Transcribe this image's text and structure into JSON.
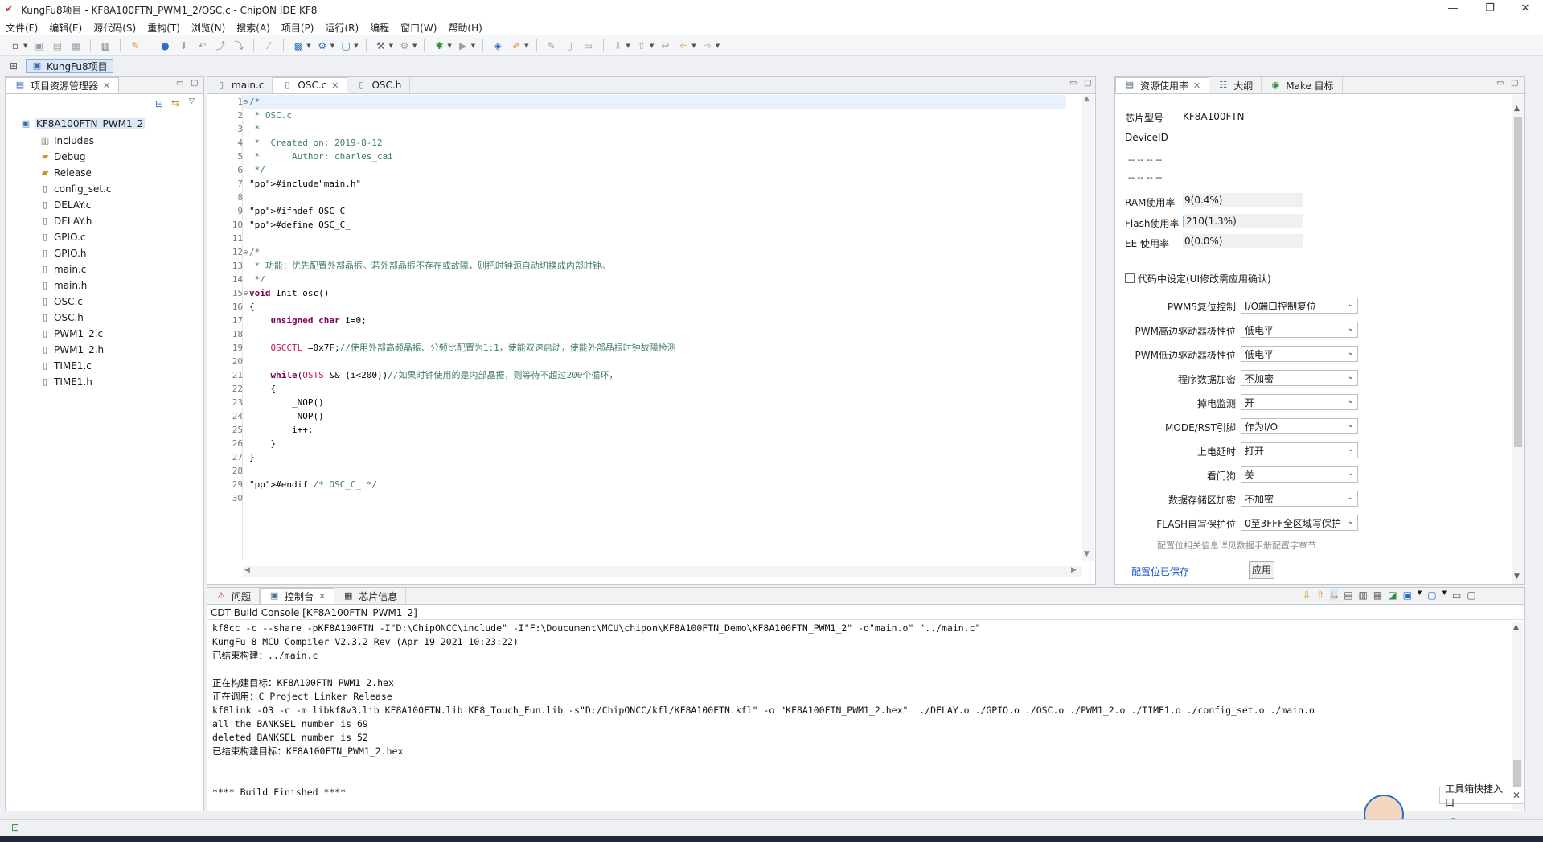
{
  "window": {
    "title": "KungFu8项目 - KF8A100FTN_PWM1_2/OSC.c - ChipON IDE KF8",
    "minimize": "—",
    "maximize": "❐",
    "close": "✕"
  },
  "menu": [
    "文件(F)",
    "编辑(E)",
    "源代码(S)",
    "重构(T)",
    "浏览(N)",
    "搜索(A)",
    "项目(P)",
    "运行(R)",
    "编程",
    "窗口(W)",
    "帮助(H)"
  ],
  "perspective": {
    "label": "KungFu8项目"
  },
  "project_explorer": {
    "tab_label": "项目资源管理器",
    "project": "KF8A100FTN_PWM1_2",
    "items": [
      {
        "label": "Includes",
        "icon": "includes-icon"
      },
      {
        "label": "Debug",
        "icon": "folder-icon"
      },
      {
        "label": "Release",
        "icon": "folder-icon"
      },
      {
        "label": "config_set.c",
        "icon": "c-file-icon"
      },
      {
        "label": "DELAY.c",
        "icon": "c-file-icon"
      },
      {
        "label": "DELAY.h",
        "icon": "h-file-icon"
      },
      {
        "label": "GPIO.c",
        "icon": "c-file-icon"
      },
      {
        "label": "GPIO.h",
        "icon": "h-file-icon"
      },
      {
        "label": "main.c",
        "icon": "c-file-icon"
      },
      {
        "label": "main.h",
        "icon": "h-file-icon"
      },
      {
        "label": "OSC.c",
        "icon": "c-file-icon"
      },
      {
        "label": "OSC.h",
        "icon": "h-file-icon"
      },
      {
        "label": "PWM1_2.c",
        "icon": "c-file-icon"
      },
      {
        "label": "PWM1_2.h",
        "icon": "h-file-icon"
      },
      {
        "label": "TIME1.c",
        "icon": "c-file-icon"
      },
      {
        "label": "TIME1.h",
        "icon": "h-file-icon"
      }
    ]
  },
  "editor": {
    "tabs": [
      {
        "label": "main.c",
        "active": false
      },
      {
        "label": "OSC.c",
        "active": true
      },
      {
        "label": "OSC.h",
        "active": false
      }
    ],
    "lines": [
      "/*",
      " * OSC.c",
      " *",
      " *  Created on: 2019-8-12",
      " *      Author: charles_cai",
      " */",
      "#include\"main.h\"",
      "",
      "#ifndef OSC_C_",
      "#define OSC_C_",
      "",
      "/*",
      " * 功能：优先配置外部晶振。若外部晶振不存在或故障，则把时钟源自动切换成内部时钟。",
      " */",
      "void Init_osc()",
      "{",
      "    unsigned char i=0;",
      "",
      "    OSCCTL =0x7F;//使用外部高频晶振、分频比配置为1:1，使能双速启动，使能外部晶振时钟故障检测",
      "",
      "    while(OSTS && (i<200))//如果时钟使用的是内部晶振，则等待不超过200个循环，",
      "    {",
      "        _NOP()",
      "        _NOP()",
      "        i++;",
      "    }",
      "}",
      "",
      "#endif /* OSC_C_ */",
      ""
    ]
  },
  "resource_panel": {
    "tabs": [
      "资源使用率",
      "大纲",
      "Make 目标"
    ],
    "chip_label": "芯片型号",
    "chip_value": "KF8A100FTN",
    "device_label": "DeviceID",
    "device_value": "----",
    "dash_rows": [
      "--  --  --  --",
      "--  --  --  --"
    ],
    "ram_label": "RAM使用率",
    "ram_value": "9(0.4%)",
    "flash_label": "Flash使用率",
    "flash_value": "210(1.3%)",
    "ee_label": "EE 使用率",
    "ee_value": "0(0.0%)",
    "code_setting_label": "代码中设定(UI修改需应用确认)",
    "config": [
      {
        "label": "PWM5复位控制",
        "value": "I/O端口控制复位"
      },
      {
        "label": "PWM高边驱动器极性位",
        "value": "低电平"
      },
      {
        "label": "PWM低边驱动器极性位",
        "value": "低电平"
      },
      {
        "label": "程序数据加密",
        "value": "不加密"
      },
      {
        "label": "掉电监测",
        "value": "开"
      },
      {
        "label": "MODE/RST引脚",
        "value": "作为I/O"
      },
      {
        "label": "上电延时",
        "value": "打开"
      },
      {
        "label": "看门狗",
        "value": "关"
      },
      {
        "label": "数据存储区加密",
        "value": "不加密"
      },
      {
        "label": "FLASH自写保护位",
        "value": "0至3FFF全区域写保护"
      }
    ],
    "note": "配置位相关信息详见数据手册配置字章节",
    "saved_link": "配置位已保存",
    "apply_button": "应用"
  },
  "console": {
    "tabs": [
      "问题",
      "控制台",
      "芯片信息"
    ],
    "header": "CDT Build Console [KF8A100FTN_PWM1_2]",
    "lines": [
      "kf8cc -c --share -pKF8A100FTN -I\"D:\\ChipONCC\\include\" -I\"F:\\Doucument\\MCU\\chipon\\KF8A100FTN_Demo\\KF8A100FTN_PWM1_2\" -o\"main.o\" \"../main.c\"",
      "KungFu 8 MCU Compiler V2.3.2 Rev (Apr 19 2021 10:23:22)",
      "已结束构建：../main.c",
      "",
      "正在构建目标：KF8A100FTN_PWM1_2.hex",
      "正在调用：C Project Linker Release",
      "kf8link -O3 -c -m libkf8v3.lib KF8A100FTN.lib KF8_Touch_Fun.lib -s\"D:/ChipONCC/kfl/KF8A100FTN.kfl\" -o \"KF8A100FTN_PWM1_2.hex\"  ./DELAY.o ./GPIO.o ./OSC.o ./PWM1_2.o ./TIME1.o ./config_set.o ./main.o",
      "all the BANKSEL number is 69",
      "deleted BANKSEL number is 52",
      "已结束构建目标：KF8A100FTN_PWM1_2.hex",
      "",
      "",
      "**** Build Finished ****"
    ]
  },
  "tooltip": {
    "label": "工具箱快捷入口"
  }
}
